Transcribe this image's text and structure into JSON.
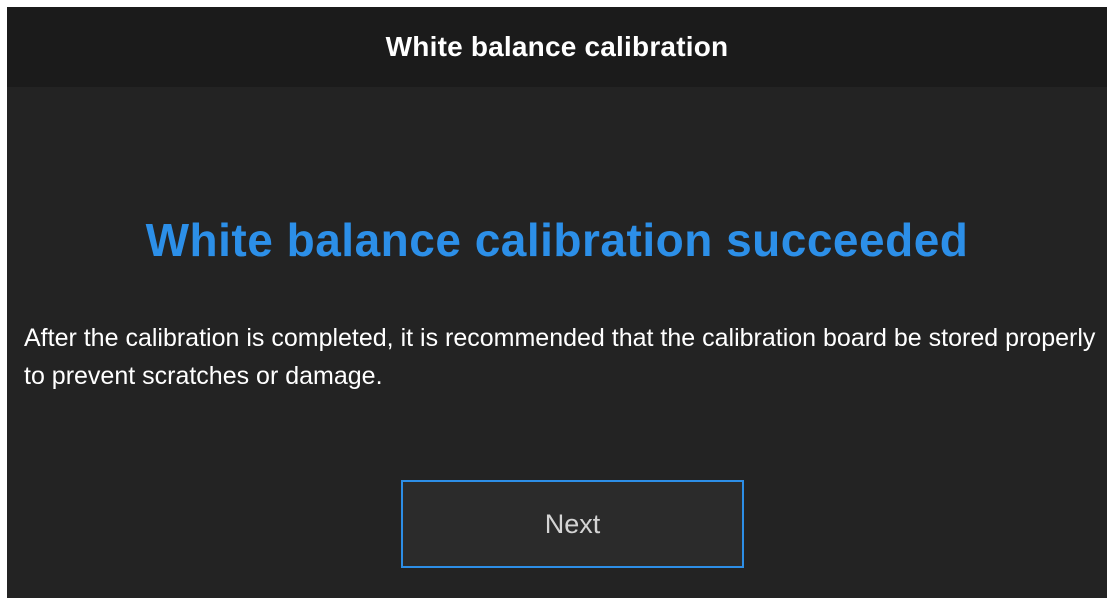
{
  "dialog": {
    "title": "White balance calibration",
    "headline": "White balance calibration succeeded",
    "message": "After the calibration is completed, it is recommended that the calibration board be stored properly to prevent scratches or damage.",
    "next_label": "Next"
  },
  "colors": {
    "background": "#232323",
    "title_bar": "#1b1b1b",
    "accent": "#2c8fe8",
    "button_border": "#2d8ee6",
    "button_text": "#d4d4d4"
  }
}
